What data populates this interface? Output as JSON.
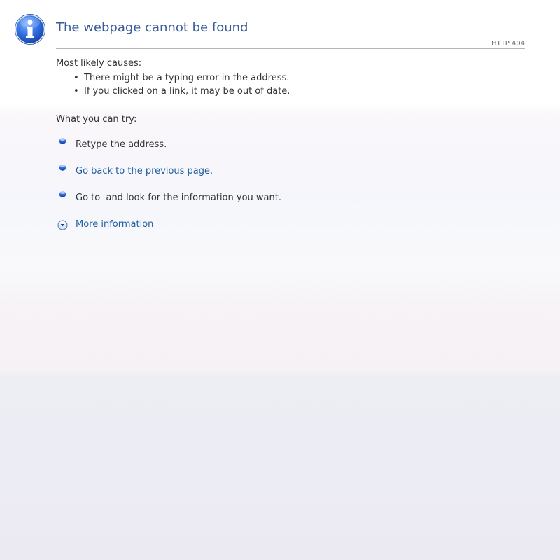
{
  "header": {
    "title": "The webpage cannot be found",
    "status_code": "HTTP 404",
    "icon": "info-icon"
  },
  "causes": {
    "heading": "Most likely causes:",
    "items": [
      "There might be a typing error in the address.",
      "If you clicked on a link, it may be out of date."
    ]
  },
  "try": {
    "heading": "What you can try:",
    "items": [
      {
        "text": "Retype the address.",
        "is_link": false,
        "icon": "blue-bullet-icon"
      },
      {
        "text": "Go back to the previous page.",
        "is_link": true,
        "icon": "blue-bullet-icon"
      },
      {
        "text": "Go to  and look for the information you want.",
        "is_link": false,
        "icon": "blue-bullet-icon"
      }
    ]
  },
  "more_info": {
    "label": "More information",
    "icon": "expand-down-icon"
  },
  "colors": {
    "title": "#3a5b9a",
    "link": "#1f5fa2",
    "text": "#333333",
    "rule": "#b5b5b5"
  }
}
